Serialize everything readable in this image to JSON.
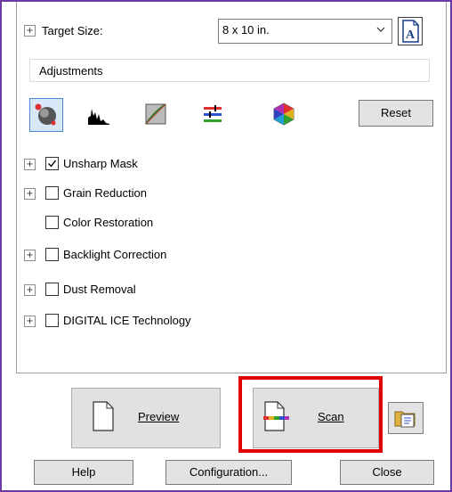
{
  "target_size": {
    "label": "Target Size:",
    "value": "8 x 10 in."
  },
  "adjustments": {
    "header": "Adjustments",
    "reset_label": "Reset"
  },
  "options": [
    {
      "label": "Unsharp Mask",
      "checked": true,
      "expandable": true
    },
    {
      "label": "Grain Reduction",
      "checked": false,
      "expandable": true
    },
    {
      "label": "Color Restoration",
      "checked": false,
      "expandable": false
    },
    {
      "label": "Backlight Correction",
      "checked": false,
      "expandable": true
    },
    {
      "label": "Dust Removal",
      "checked": false,
      "expandable": true
    },
    {
      "label": "DIGITAL ICE Technology",
      "checked": false,
      "expandable": true
    }
  ],
  "actions": {
    "preview_label": "Preview",
    "scan_label": "Scan"
  },
  "footer": {
    "help_label": "Help",
    "configuration_label": "Configuration...",
    "close_label": "Close"
  },
  "colors": {
    "window_border": "#6b3aa6",
    "highlight": "#e00000",
    "selected_tool": "#4a8bd6"
  },
  "icons": [
    "auto-exposure-icon",
    "histogram-icon",
    "tone-curve-icon",
    "image-adjustment-icon",
    "color-palette-icon",
    "document-icon",
    "folder-icon"
  ]
}
